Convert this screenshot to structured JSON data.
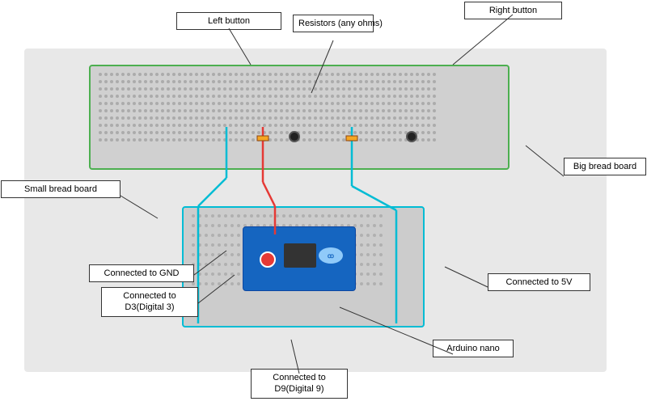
{
  "labels": {
    "left_button": "Left button",
    "right_button": "Right button",
    "resistors": "Resistors\n(any ohms)",
    "small_breadboard": "Small bread board",
    "big_breadboard": "Big bread board",
    "connected_gnd": "Connected to GND",
    "connected_d3": "Connected to\nD3(Digital 3)",
    "connected_d9": "Connected to\nD9(Digital 9)",
    "connected_5v": "Connected to 5V",
    "arduino_nano": "Arduino nano",
    "arduino_logo": "ꝏ"
  },
  "colors": {
    "big_breadboard_border": "#4CAF50",
    "small_breadboard_border": "#00BCD4",
    "red_wire": "#E53935",
    "blue_wire": "#00BCD4",
    "label_border": "#333333",
    "arduino_blue": "#1565C0"
  }
}
